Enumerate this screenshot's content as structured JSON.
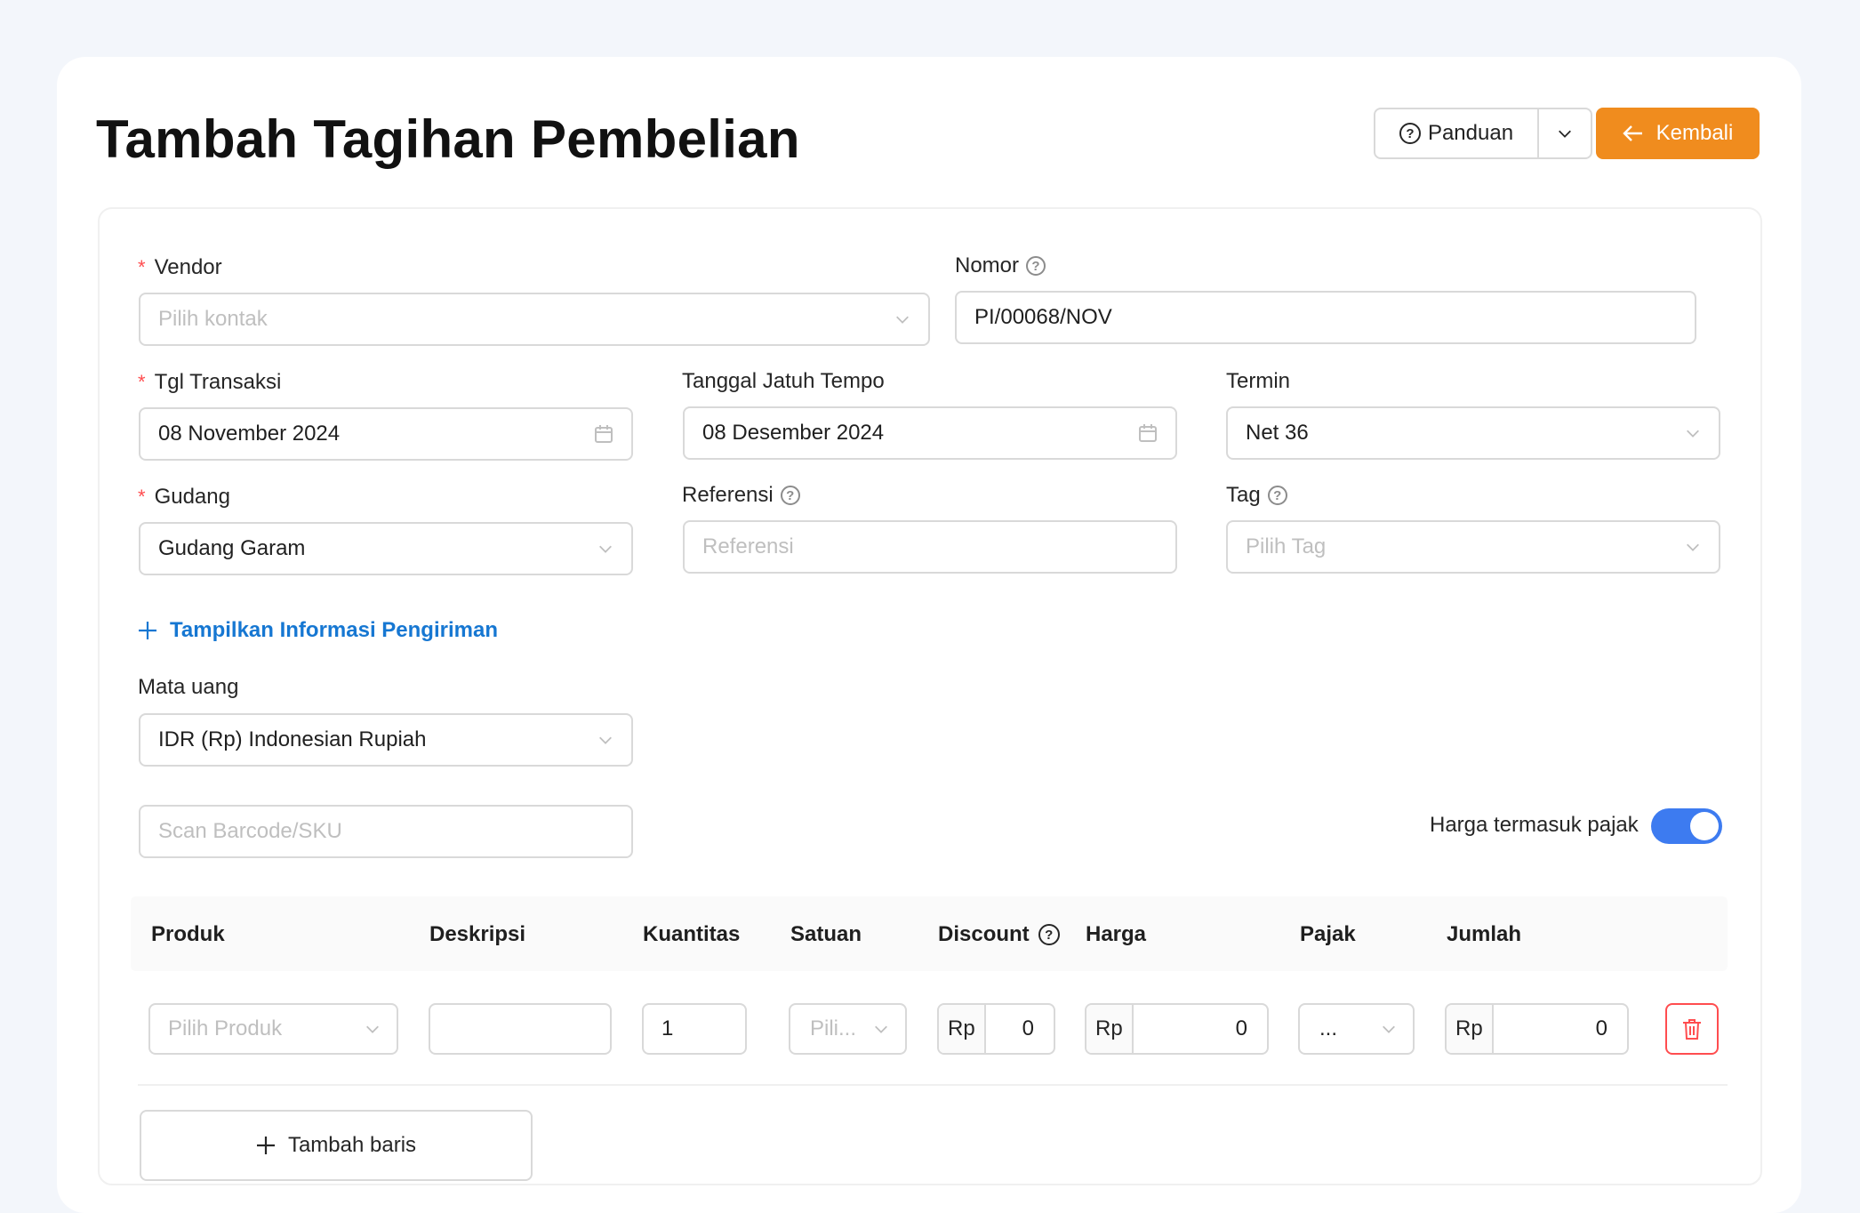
{
  "header": {
    "title": "Tambah Tagihan Pembelian",
    "guide_label": "Panduan",
    "back_label": "Kembali"
  },
  "form": {
    "vendor": {
      "label": "Vendor",
      "placeholder": "Pilih kontak"
    },
    "nomor": {
      "label": "Nomor",
      "value": "PI/00068/NOV"
    },
    "tgl_transaksi": {
      "label": "Tgl Transaksi",
      "value": "08 November 2024"
    },
    "jatuh_tempo": {
      "label": "Tanggal Jatuh Tempo",
      "value": "08 Desember 2024"
    },
    "termin": {
      "label": "Termin",
      "value": "Net 36"
    },
    "gudang": {
      "label": "Gudang",
      "value": "Gudang Garam"
    },
    "referensi": {
      "label": "Referensi",
      "placeholder": "Referensi"
    },
    "tag": {
      "label": "Tag",
      "placeholder": "Pilih Tag"
    },
    "shipping_link": "Tampilkan Informasi Pengiriman",
    "mata_uang": {
      "label": "Mata uang",
      "value": "IDR (Rp) Indonesian Rupiah"
    },
    "scan": {
      "placeholder": "Scan Barcode/SKU"
    },
    "tax_toggle": {
      "label": "Harga termasuk pajak",
      "on": true
    }
  },
  "table": {
    "columns": [
      "Produk",
      "Deskripsi",
      "Kuantitas",
      "Satuan",
      "Discount",
      "Harga",
      "Pajak",
      "Jumlah"
    ],
    "row": {
      "produk_placeholder": "Pilih Produk",
      "deskripsi": "",
      "kuantitas": "1",
      "satuan_placeholder": "Pili...",
      "currency": "Rp",
      "discount": "0",
      "harga": "0",
      "pajak": "...",
      "jumlah": "0"
    },
    "add_row_label": "Tambah baris"
  },
  "colors": {
    "accent_orange": "#f08c1e",
    "link_blue": "#1677d2",
    "toggle_blue": "#3d7bf0",
    "danger": "#ff4d4f"
  }
}
